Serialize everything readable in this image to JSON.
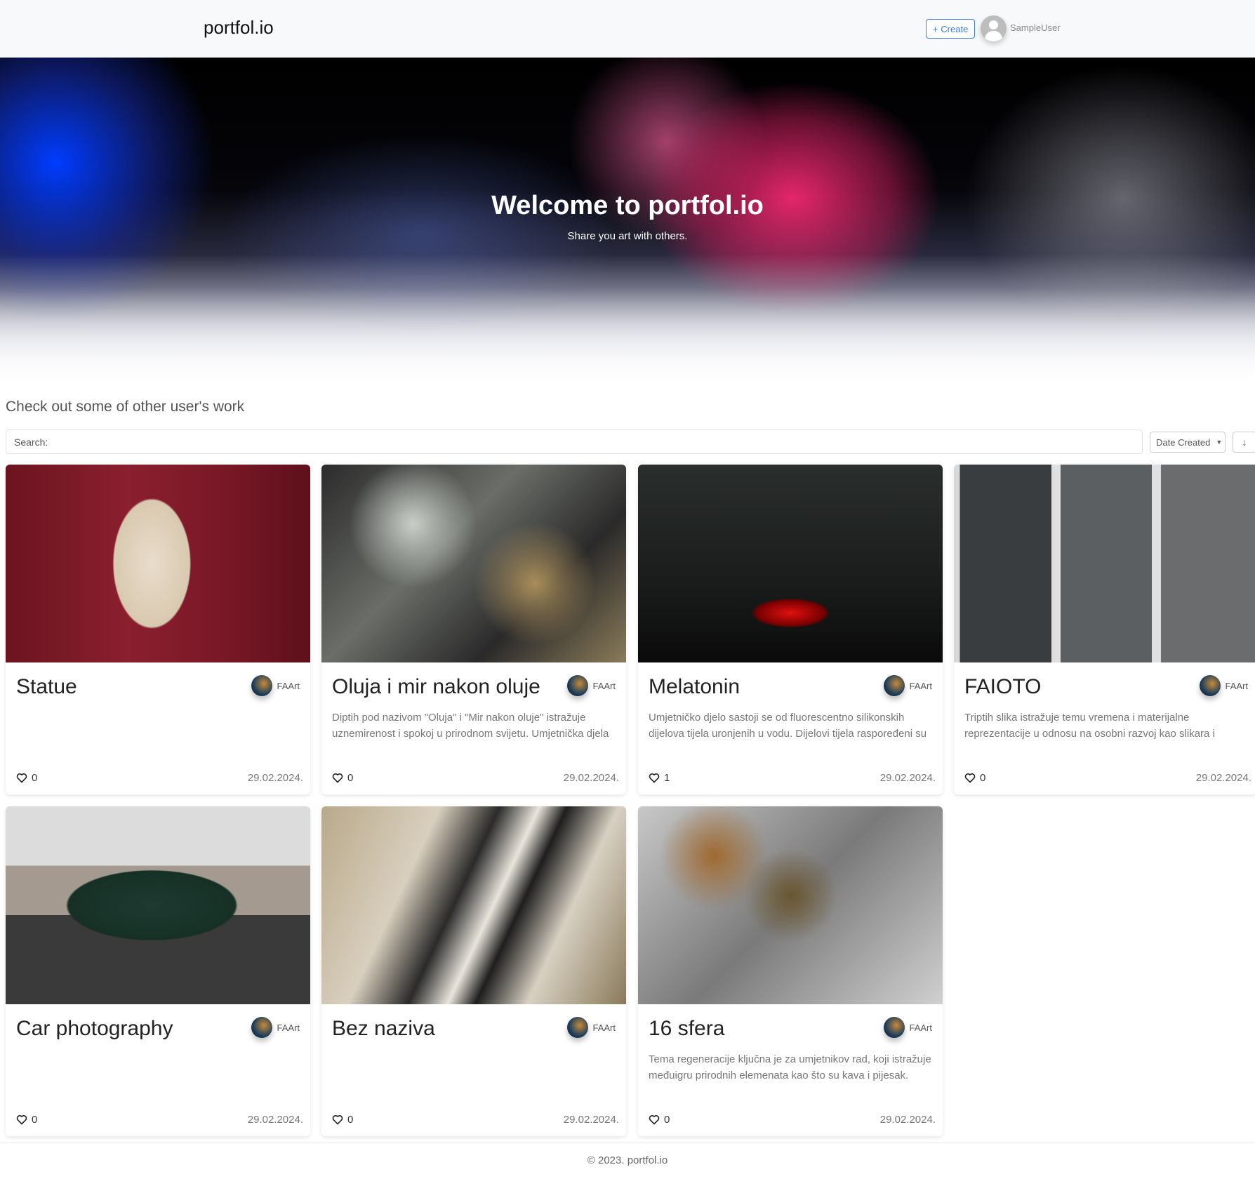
{
  "nav": {
    "logo": "portfol.io",
    "create_label": "Create",
    "username": "SampleUser"
  },
  "hero": {
    "title": "Welcome to portfol.io",
    "subtitle": "Share you art with others."
  },
  "section_title": "Check out some of other user's work",
  "search": {
    "label": "Search:"
  },
  "sort": {
    "selected": "Date Created",
    "direction_icon": "arrow-down"
  },
  "cards": [
    {
      "title": "Statue",
      "author": "FAArt",
      "description": "",
      "likes": "0",
      "date": "29.02.2024."
    },
    {
      "title": "Oluja i mir nakon oluje",
      "author": "FAArt",
      "description": "Diptih pod nazivom \"Oluja\" i \"Mir nakon oluje\" istražuje uznemirenost i spokoj u prirodnom svijetu. Umjetnička djela",
      "likes": "0",
      "date": "29.02.2024."
    },
    {
      "title": "Melatonin",
      "author": "FAArt",
      "description": "Umjetničko djelo sastoji se od fluorescentno silikonskih dijelova tijela uronjenih u vodu. Dijelovi tijela raspoređeni su",
      "likes": "1",
      "date": "29.02.2024."
    },
    {
      "title": "FAIOTO",
      "author": "FAArt",
      "description": "Triptih slika istražuje temu vremena i materijalne reprezentacije u odnosu na osobni razvoj kao slikara i",
      "likes": "0",
      "date": "29.02.2024."
    },
    {
      "title": "Car photography",
      "author": "FAArt",
      "description": "",
      "likes": "0",
      "date": "29.02.2024."
    },
    {
      "title": "Bez naziva",
      "author": "FAArt",
      "description": "",
      "likes": "0",
      "date": "29.02.2024."
    },
    {
      "title": "16 sfera",
      "author": "FAArt",
      "description": "Tema regeneracije ključna je za umjetnikov rad, koji istražuje međuigru prirodnih elemenata kao što su kava i pijesak.",
      "likes": "0",
      "date": "29.02.2024."
    }
  ],
  "footer": "© 2023. portfol.io"
}
